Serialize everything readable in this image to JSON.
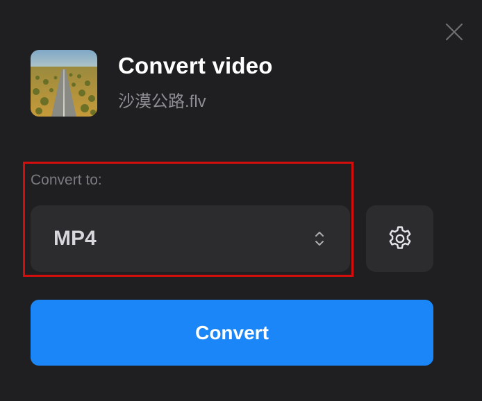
{
  "dialog": {
    "title": "Convert video",
    "filename": "沙漠公路.flv",
    "thumbnail_icon": "desert-road-thumbnail"
  },
  "format": {
    "label": "Convert to:",
    "selected": "MP4",
    "icon": "chevron-up-down-icon"
  },
  "settings": {
    "icon": "gear-icon"
  },
  "actions": {
    "convert_label": "Convert",
    "close_icon": "close-icon"
  },
  "colors": {
    "background": "#1f1f22",
    "panel": "#2c2c2f",
    "accent": "#1a86f7",
    "highlight": "#d40d0d"
  }
}
